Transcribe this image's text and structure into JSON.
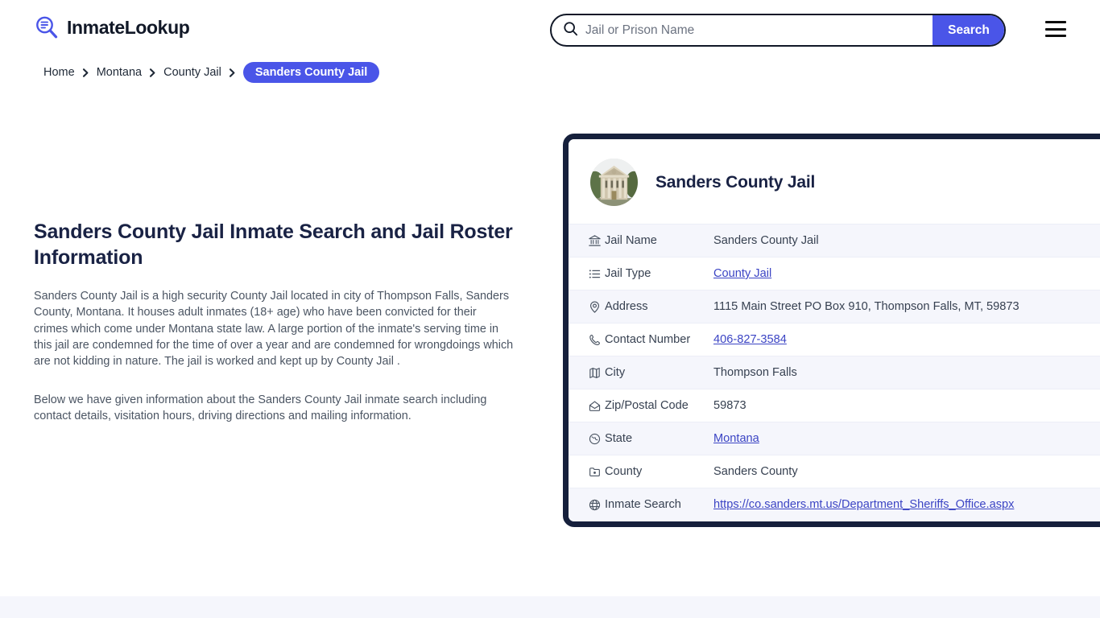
{
  "header": {
    "logo_text": "InmateLookup",
    "logo_icon": "magnifier-list-icon",
    "search": {
      "placeholder": "Jail or Prison Name",
      "value": "",
      "icon": "search-icon",
      "button_label": "Search"
    },
    "menu_icon": "hamburger-menu-icon"
  },
  "breadcrumb": {
    "items": [
      {
        "label": "Home",
        "current": false
      },
      {
        "label": "Montana",
        "current": false
      },
      {
        "label": "County Jail",
        "current": false
      },
      {
        "label": "Sanders County Jail",
        "current": true
      }
    ],
    "separator_icon": "chevron-right-icon"
  },
  "main": {
    "title": "Sanders County Jail Inmate Search and Jail Roster Information",
    "paragraph_1": "Sanders County Jail is a high security County Jail located in city of Thompson Falls, Sanders County, Montana. It houses adult inmates (18+ age) who have been convicted for their crimes which come under Montana state law. A large portion of the inmate's serving time in this jail are condemned for the time of over a year and are condemned for wrongdoings which are not kidding in nature. The jail is worked and kept up by County Jail .",
    "paragraph_2": "Below we have given information about the Sanders County Jail inmate search including contact details, visitation hours, driving directions and mailing information."
  },
  "card": {
    "title": "Sanders County Jail",
    "avatar_icon": "courthouse-photo",
    "rows": [
      {
        "icon": "bank-building-icon",
        "label": "Jail Name",
        "value": "Sanders County Jail",
        "link": false
      },
      {
        "icon": "list-icon",
        "label": "Jail Type",
        "value": "County Jail",
        "link": true
      },
      {
        "icon": "map-pin-icon",
        "label": "Address",
        "value": "1115 Main Street PO Box 910, Thompson Falls, MT, 59873",
        "link": false
      },
      {
        "icon": "phone-icon",
        "label": "Contact Number",
        "value": "406-827-3584",
        "link": true
      },
      {
        "icon": "map-icon",
        "label": "City",
        "value": "Thompson Falls",
        "link": false
      },
      {
        "icon": "envelope-icon",
        "label": "Zip/Postal Code",
        "value": "59873",
        "link": false
      },
      {
        "icon": "globe-compass-icon",
        "label": "State",
        "value": "Montana",
        "link": true
      },
      {
        "icon": "folder-dot-icon",
        "label": "County",
        "value": "Sanders County",
        "link": false
      },
      {
        "icon": "globe-icon",
        "label": "Inmate Search",
        "value": "https://co.sanders.mt.us/Department_Sheriffs_Office.aspx",
        "link": true
      }
    ]
  },
  "colors": {
    "accent": "#4a55e8",
    "card_border": "#16203c",
    "heading": "#192244",
    "link": "#3b44c4",
    "row_alt": "#f5f6fc",
    "footer_band": "#f5f6fc"
  }
}
